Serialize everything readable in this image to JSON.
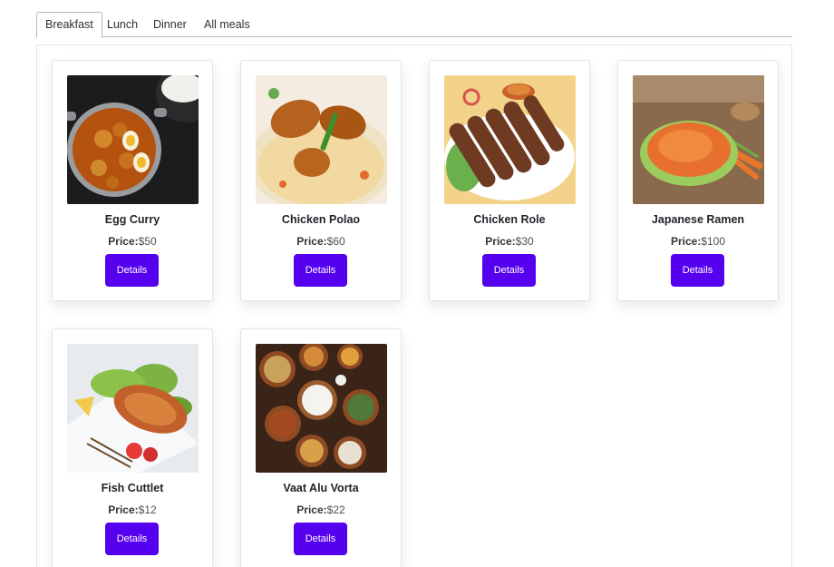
{
  "tabs": [
    {
      "label": "Breakfast",
      "active": true
    },
    {
      "label": "Lunch",
      "active": false
    },
    {
      "label": "Dinner",
      "active": false
    },
    {
      "label": "All meals",
      "active": false
    }
  ],
  "price_label": "Price:",
  "details_label": "Details",
  "accent_color": "#5500ee",
  "meals": [
    {
      "name": "Egg Curry",
      "price": "$50",
      "image": "egg-curry-photo"
    },
    {
      "name": "Chicken Polao",
      "price": "$60",
      "image": "chicken-polao-photo"
    },
    {
      "name": "Chicken Role",
      "price": "$30",
      "image": "chicken-role-photo"
    },
    {
      "name": "Japanese Ramen",
      "price": "$100",
      "image": "japanese-ramen-photo"
    },
    {
      "name": "Fish Cuttlet",
      "price": "$12",
      "image": "fish-cuttlet-photo"
    },
    {
      "name": "Vaat Alu Vorta",
      "price": "$22",
      "image": "vaat-alu-vorta-photo"
    }
  ]
}
